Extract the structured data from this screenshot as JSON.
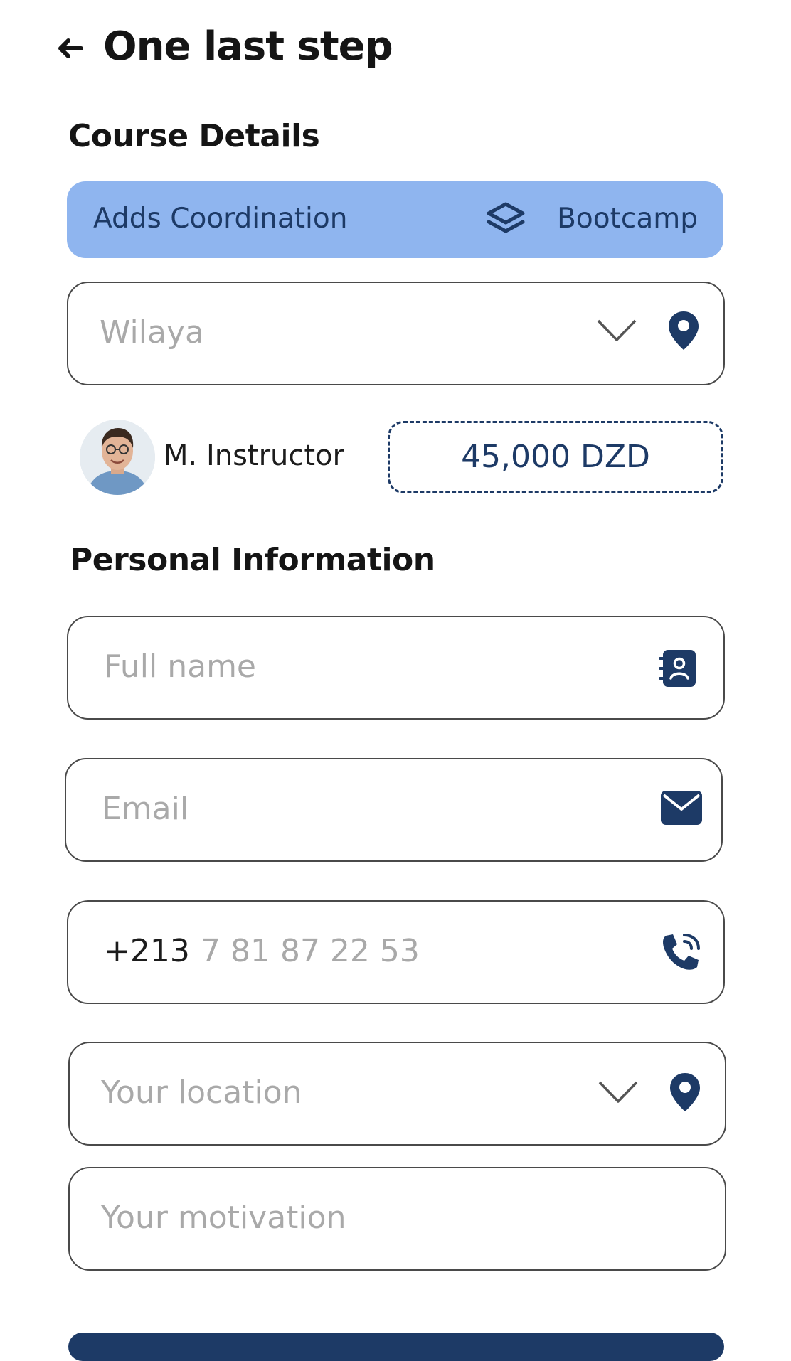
{
  "header": {
    "title": "One last step"
  },
  "course_details": {
    "heading": "Course Details",
    "course_name": "Adds Coordination",
    "course_type": "Bootcamp",
    "wilaya_placeholder": "Wilaya",
    "instructor_name": "M. Instructor",
    "price": "45,000 DZD"
  },
  "personal_info": {
    "heading": "Personal Information",
    "full_name_placeholder": "Full name",
    "email_placeholder": "Email",
    "phone_prefix": "+213",
    "phone_placeholder": "7 81 87 22 53",
    "location_placeholder": "Your location",
    "motivation_placeholder": "Your motivation"
  },
  "colors": {
    "accent_dark": "#1d3a66",
    "course_bar_bg": "#8fb5ef",
    "placeholder": "#a9a9a9"
  },
  "icons": [
    "back-arrow-icon",
    "layers-icon",
    "chevron-down-icon",
    "location-pin-icon",
    "contact-book-icon",
    "mail-icon",
    "phone-call-icon"
  ]
}
